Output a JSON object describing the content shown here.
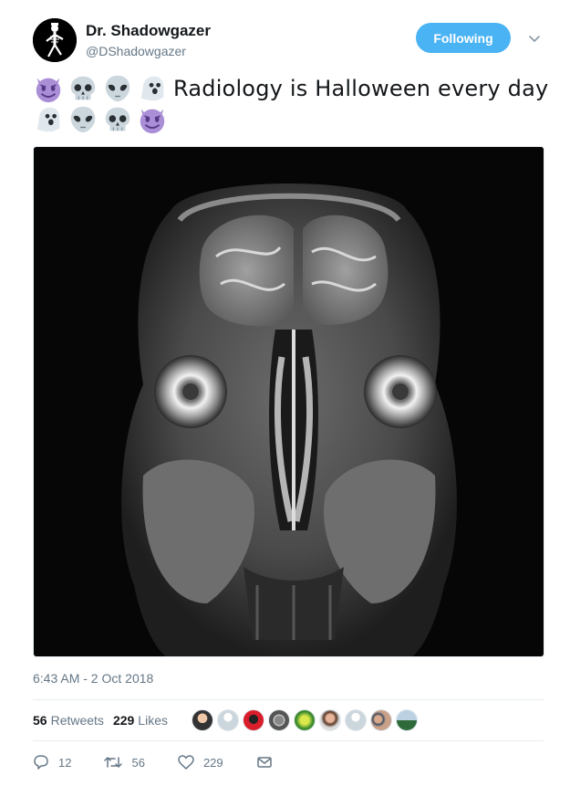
{
  "user": {
    "name": "Dr. Shadowgazer",
    "handle": "@DShadowgazer",
    "follow_label": "Following"
  },
  "tweet": {
    "text": "Radiology is Halloween every day",
    "emojis_line1": [
      "smiling-imp",
      "skull",
      "alien",
      "ghost"
    ],
    "emojis_line2": [
      "ghost",
      "alien",
      "skull",
      "smiling-imp"
    ],
    "media_description": "coronal MRI brain scan",
    "timestamp": "6:43 AM - 2 Oct 2018"
  },
  "stats": {
    "retweets_count": "56",
    "retweets_label": "Retweets",
    "likes_count": "229",
    "likes_label": "Likes",
    "liker_count": 10
  },
  "actions": {
    "reply_count": "12",
    "retweet_count": "56",
    "like_count": "229"
  },
  "colors": {
    "accent": "#4ab3f4",
    "muted": "#657786",
    "imp": "#aa8ed6",
    "skull": "#ccd6dd"
  }
}
